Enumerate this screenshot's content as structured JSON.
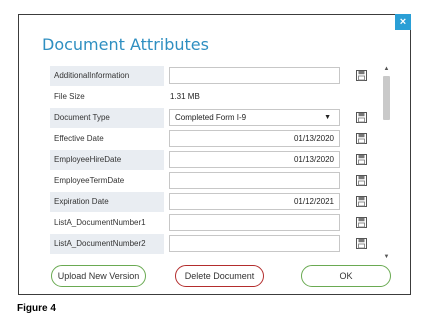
{
  "dialog": {
    "title": "Document Attributes",
    "close_glyph": "×"
  },
  "fields": [
    {
      "label": "AdditionalInformation",
      "kind": "input",
      "value": "",
      "save_icon": "floppy-disk-icon"
    },
    {
      "label": "File Size",
      "kind": "static",
      "value": "1.31 MB"
    },
    {
      "label": "Document Type",
      "kind": "select",
      "value": "Completed Form I-9",
      "save_icon": "floppy-disk-icon"
    },
    {
      "label": "Effective Date",
      "kind": "input",
      "value": "01/13/2020",
      "save_icon": "floppy-disk-icon"
    },
    {
      "label": "EmployeeHireDate",
      "kind": "input",
      "value": "01/13/2020",
      "save_icon": "floppy-disk-icon"
    },
    {
      "label": "EmployeeTermDate",
      "kind": "input",
      "value": "",
      "save_icon": "floppy-disk-icon"
    },
    {
      "label": "Expiration Date",
      "kind": "input",
      "value": "01/12/2021",
      "save_icon": "floppy-disk-icon"
    },
    {
      "label": "ListA_DocumentNumber1",
      "kind": "input",
      "value": "",
      "save_icon": "floppy-disk-icon"
    },
    {
      "label": "ListA_DocumentNumber2",
      "kind": "input",
      "value": "",
      "save_icon": "floppy-disk-icon"
    }
  ],
  "scrollbar": {
    "up_glyph": "▲",
    "down_glyph": "▼"
  },
  "buttons": {
    "upload": "Upload New Version",
    "delete": "Delete Document",
    "ok": "OK"
  },
  "colors": {
    "title": "#2f8fc1",
    "close_bg": "#2a9fd6",
    "upload_border": "#6aaa52",
    "delete_border": "#b32d2d",
    "ok_border": "#6aaa52",
    "label_shade": "#e9edf2"
  },
  "caption": "Figure 4"
}
